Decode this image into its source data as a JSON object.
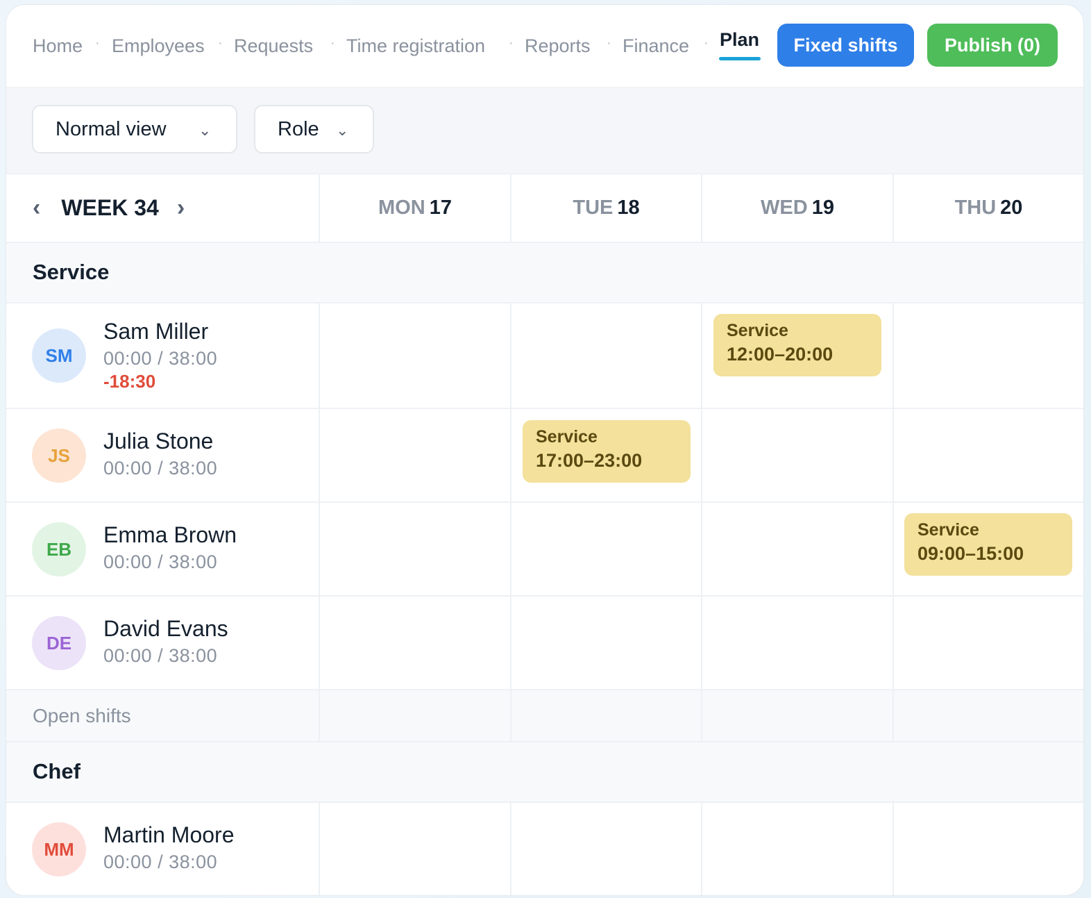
{
  "nav": {
    "items": [
      "Home",
      "Employees",
      "Requests",
      "Time registration",
      "Reports",
      "Finance"
    ],
    "separator": "·",
    "active": "Plan",
    "fixed_shifts_label": "Fixed shifts",
    "publish_label": "Publish (0)"
  },
  "filters": {
    "view": "Normal view",
    "group": "Role"
  },
  "week": {
    "label": "WEEK 34",
    "prev": "‹",
    "next": "›",
    "days": [
      {
        "name": "MON",
        "date": "17"
      },
      {
        "name": "TUE",
        "date": "18"
      },
      {
        "name": "WED",
        "date": "19"
      },
      {
        "name": "THU",
        "date": "20"
      }
    ]
  },
  "sections": {
    "service": {
      "title": "Service",
      "employees": [
        {
          "initials": "SM",
          "name": "Sam Miller",
          "hours": "00:00 / 38:00",
          "diff": "-18:30"
        },
        {
          "initials": "JS",
          "name": "Julia Stone",
          "hours": "00:00 / 38:00"
        },
        {
          "initials": "EB",
          "name": "Emma Brown",
          "hours": "00:00 / 38:00"
        },
        {
          "initials": "DE",
          "name": "David Evans",
          "hours": "00:00 / 38:00"
        }
      ],
      "open_shifts_label": "Open shifts"
    },
    "chef": {
      "title": "Chef",
      "employees": [
        {
          "initials": "MM",
          "name": "Martin Moore",
          "hours": "00:00 / 38:00"
        }
      ]
    }
  },
  "shifts": [
    {
      "employee": "Sam Miller",
      "day": "WED",
      "role": "Service",
      "time": "12:00–20:00"
    },
    {
      "employee": "Julia Stone",
      "day": "TUE",
      "role": "Service",
      "time": "17:00–23:00"
    },
    {
      "employee": "Emma Brown",
      "day": "THU",
      "role": "Service",
      "time": "09:00–15:00"
    }
  ],
  "colors": {
    "primary": "#2f7fe8",
    "success": "#4fbd5a",
    "active_underline": "#1aa3d7",
    "shift_bg": "#f3e19c",
    "negative": "#e04c3a"
  }
}
